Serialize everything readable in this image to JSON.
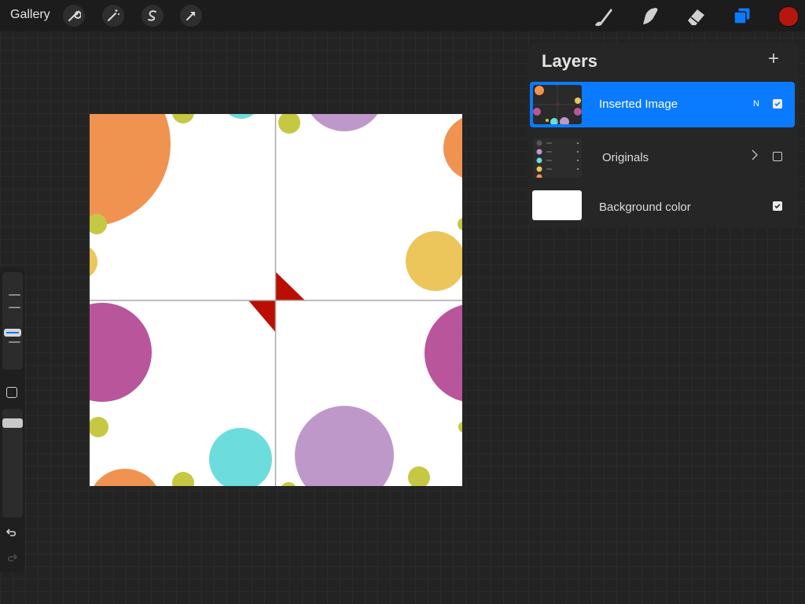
{
  "toolbar": {
    "gallery_label": "Gallery",
    "left_tools": [
      "wrench-icon",
      "magic-wand-icon",
      "selection-icon",
      "transform-arrow-icon"
    ],
    "right_tools": [
      "brush-icon",
      "smudge-icon",
      "eraser-icon",
      "layers-icon"
    ],
    "current_color": "#b5160e"
  },
  "layers": {
    "title": "Layers",
    "add_icon": "plus-icon",
    "items": [
      {
        "name": "Inserted Image",
        "blend_mode": "N",
        "visible": true,
        "selected": true
      },
      {
        "name": "Originals",
        "is_group": true,
        "visible": false,
        "selected": false
      },
      {
        "name": "Background color",
        "visible": true,
        "selected": false
      }
    ]
  },
  "sidebar": {
    "brush_size": "slider",
    "opacity": "slider",
    "modify_button": "square-icon",
    "undo": "undo-icon",
    "redo": "redo-icon"
  },
  "palette": {
    "orange": "#f09351",
    "olive": "#c6c843",
    "cyan": "#6ddcdc",
    "lavender": "#bf98ca",
    "yellow": "#ecc55b",
    "magenta": "#b9559b",
    "red": "#bb0e02",
    "accent": "#0a7bff"
  }
}
